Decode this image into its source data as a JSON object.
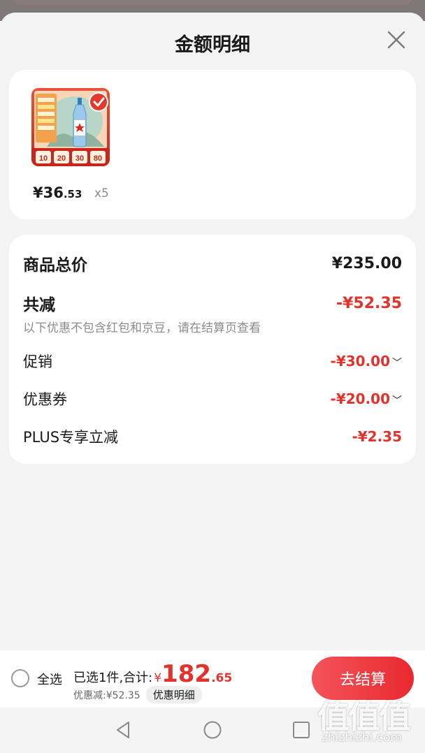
{
  "sheet": {
    "title": "金额明细",
    "close_icon": "close-icon"
  },
  "product": {
    "image_icon": "baijiu-bottle-thumbnail",
    "thumbnail_tiles": [
      "10",
      "20",
      "30",
      "80"
    ],
    "price_int": "¥36",
    "price_dec": ".53",
    "quantity": "x5"
  },
  "detail": {
    "total_label": "商品总价",
    "total_value": "¥235.00",
    "discount_label": "共减",
    "discount_value": "-¥52.35",
    "discount_note": "以下优惠不包含红包和京豆，请在结算页查看",
    "items": [
      {
        "label": "促销",
        "value": "-¥30.00",
        "expandable": true
      },
      {
        "label": "优惠券",
        "value": "-¥20.00",
        "expandable": true
      },
      {
        "label": "PLUS专享立减",
        "value": "-¥2.35",
        "expandable": false
      }
    ]
  },
  "bottom_bar": {
    "select_all": "全选",
    "summary_prefix": "已选1件,合计:",
    "yen": "¥",
    "total_int": "182",
    "total_dec": ".65",
    "saved_text": "优惠减:¥52.35",
    "detail_chip": "优惠明细",
    "checkout_label": "去结算"
  },
  "watermark": {
    "glyphs": "值值值",
    "url": "zhizhizhi.com"
  },
  "colors": {
    "accent_red": "#e3322c",
    "checkout_gradient_start": "#f5535a",
    "checkout_gradient_end": "#e8292f"
  }
}
